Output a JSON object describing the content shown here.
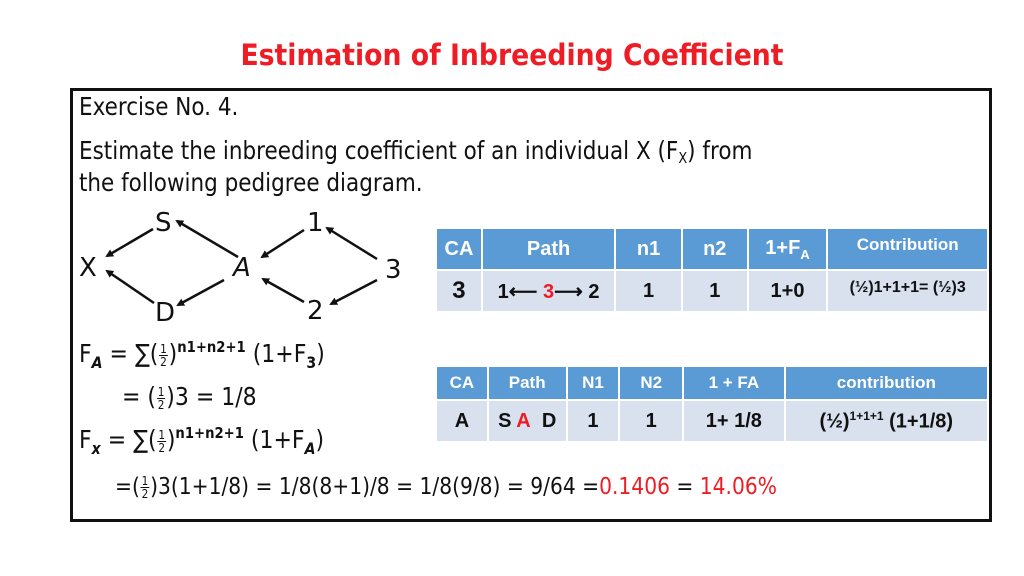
{
  "title": "Estimation of Inbreeding Coefficient",
  "exercise": "Exercise No. 4.",
  "question": {
    "line1_pre": "Estimate the inbreeding coefficient of an individual X (F",
    "line1_sub": "X",
    "line1_post": ") from",
    "line2": "the following pedigree diagram."
  },
  "pedigree": {
    "nodes": {
      "X": "X",
      "S": "S",
      "D": "D",
      "A": "A",
      "n1": "1",
      "n2": "2",
      "n3": "3"
    },
    "edges": [
      [
        "S",
        "X"
      ],
      [
        "D",
        "X"
      ],
      [
        "A",
        "S"
      ],
      [
        "A",
        "D"
      ],
      [
        "1",
        "A"
      ],
      [
        "2",
        "A"
      ],
      [
        "3",
        "1"
      ],
      [
        "3",
        "2"
      ]
    ]
  },
  "table1": {
    "headers": [
      "CA",
      "Path",
      "n1",
      "n2",
      "1+F",
      "Contribution"
    ],
    "header_sub": "A",
    "row": {
      "ca": "3",
      "path_left": "1",
      "path_mid": "3",
      "path_right": "2",
      "n1": "1",
      "n2": "1",
      "fa": "1+0",
      "contribution": "(½)1+1+1= (½)3"
    }
  },
  "table2": {
    "headers": [
      "CA",
      "Path",
      "N1",
      "N2",
      "1 + FA",
      "contribution"
    ],
    "row": {
      "ca": "A",
      "path_s": "S",
      "path_a": "A",
      "path_d": "D",
      "n1": "1",
      "n2": "1",
      "fa": "1+ 1/8",
      "contribution_base": "(½)",
      "contribution_exp": "1+1+1",
      "contribution_tail": " (1+1/8)"
    }
  },
  "formulas": {
    "fa_lhs": "F",
    "fa_sub": "A",
    "fa_eq": " = ∑(",
    "fa_exp": "n1+n2+1",
    "fa_tail": " (1+F",
    "fa_tail_sub": "3",
    "fa_close": ")",
    "fa_line2_pre": "= (",
    "fa_line2_post": ")3  = 1/8",
    "fx_lhs": "F",
    "fx_sub": "x",
    "fx_eq": " = ∑(",
    "fx_exp": "n1+n2+1",
    "fx_tail": " (1+F",
    "fx_tail_sub": "A",
    "fx_close": ")",
    "frac_num": "1",
    "frac_den": "2",
    "final_pre": "=(",
    "final_mid": ")3(1+1/8) = 1/8(8+1)/8 = 1/8(9/8) = 9/64 =",
    "final_decimal": "0.1406",
    "final_eq": " = ",
    "final_percent": "14.06%"
  },
  "colors": {
    "accent": "#ee1c24",
    "table_header": "#5b9bd5",
    "table_body": "#d9e1ef"
  }
}
